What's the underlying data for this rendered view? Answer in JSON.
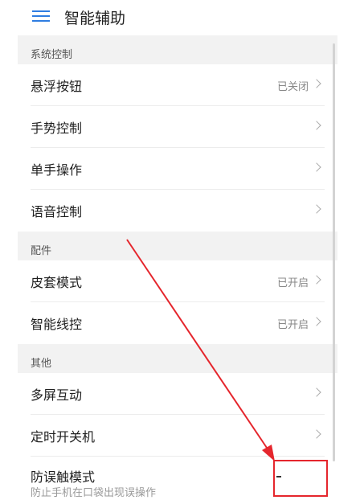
{
  "header": {
    "title": "智能辅助"
  },
  "sections": [
    {
      "label": "系统控制"
    },
    {
      "label": "配件"
    },
    {
      "label": "其他"
    }
  ],
  "rows": [
    {
      "label": "悬浮按钮",
      "value": "已关闭"
    },
    {
      "label": "手势控制",
      "value": ""
    },
    {
      "label": "单手操作",
      "value": ""
    },
    {
      "label": "语音控制",
      "value": ""
    },
    {
      "label": "皮套模式",
      "value": "已开启"
    },
    {
      "label": "智能线控",
      "value": "已开启"
    },
    {
      "label": "多屏互动",
      "value": ""
    },
    {
      "label": "定时开关机",
      "value": ""
    },
    {
      "label": "防误触模式",
      "subtitle": "防止手机在口袋出现误操作"
    }
  ],
  "colors": {
    "accent": "#2f7de1",
    "annotation": "#e5262d"
  }
}
